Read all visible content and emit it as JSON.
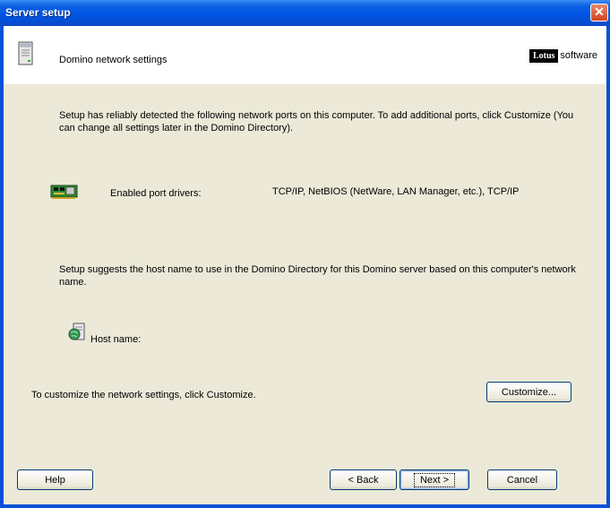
{
  "window": {
    "title": "Server setup",
    "close_glyph": "✕"
  },
  "header": {
    "title": "Domino network settings",
    "logo_box": "Lotus",
    "logo_word": "software",
    "icon": "server-icon"
  },
  "body": {
    "intro": "Setup has reliably detected the following network ports on this computer. To add additional ports, click Customize (You can change all settings later in the Domino Directory).",
    "ports_label": "Enabled port drivers:",
    "ports_value": "TCP/IP, NetBIOS (NetWare, LAN Manager, etc.), TCP/IP",
    "host_intro": "Setup suggests the host name to use in the Domino Directory for this Domino server based on this computer's network name.",
    "host_label": "Host name:",
    "customize_text": "To customize the network settings, click Customize."
  },
  "buttons": {
    "customize": "Customize...",
    "help": "Help",
    "back": "< Back",
    "next": "Next >",
    "cancel": "Cancel"
  },
  "colors": {
    "titlebar": "#0054e3",
    "frame": "#0a50d8",
    "dialog_bg": "#ece9d8",
    "close": "#d5441c"
  }
}
